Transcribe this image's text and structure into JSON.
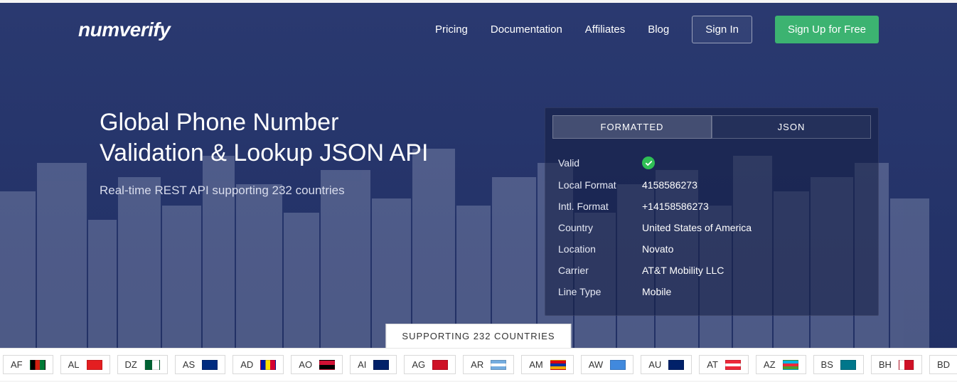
{
  "brand": "numverify",
  "nav": {
    "pricing": "Pricing",
    "documentation": "Documentation",
    "affiliates": "Affiliates",
    "blog": "Blog",
    "signin": "Sign In",
    "signup": "Sign Up for Free"
  },
  "hero": {
    "headline_line1": "Global Phone Number",
    "headline_line2": "Validation & Lookup JSON API",
    "subhead": "Real-time REST API supporting 232 countries"
  },
  "panel": {
    "tabs": {
      "formatted": "FORMATTED",
      "json": "JSON"
    },
    "labels": {
      "valid": "Valid",
      "local_format": "Local Format",
      "intl_format": "Intl. Format",
      "country": "Country",
      "location": "Location",
      "carrier": "Carrier",
      "line_type": "Line Type"
    },
    "values": {
      "local_format": "4158586273",
      "intl_format": "+14158586273",
      "country": "United States of America",
      "location": "Novato",
      "carrier": "AT&T Mobility LLC",
      "line_type": "Mobile"
    }
  },
  "support_badge": "SUPPORTING 232 COUNTRIES",
  "countries": {
    "af": "AF",
    "al": "AL",
    "dz": "DZ",
    "as": "AS",
    "ad": "AD",
    "ao": "AO",
    "ai": "AI",
    "ag": "AG",
    "ar": "AR",
    "am": "AM",
    "aw": "AW",
    "au": "AU",
    "at": "AT",
    "az": "AZ",
    "bs": "BS",
    "bh": "BH",
    "bd": "BD"
  }
}
